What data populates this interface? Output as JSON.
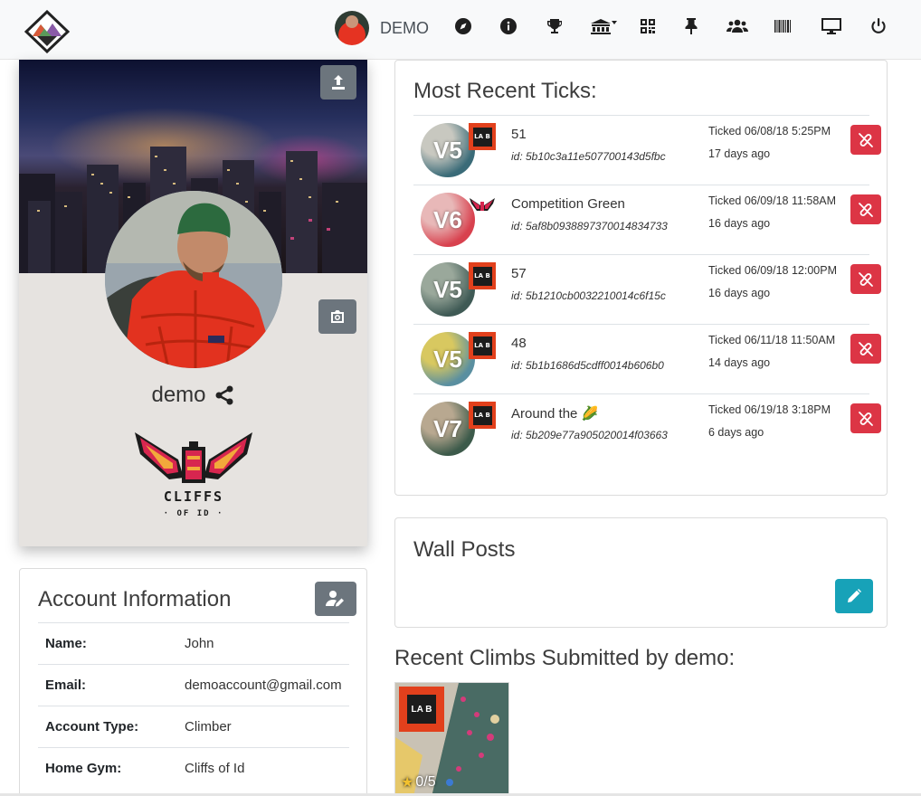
{
  "nav": {
    "username": "DEMO",
    "icons": [
      "compass-icon",
      "info-icon",
      "trophy-icon",
      "gym-dropdown-icon",
      "qr-code-icon",
      "pin-icon",
      "users-icon",
      "barcode-icon",
      "monitor-icon",
      "power-icon"
    ]
  },
  "profile": {
    "username": "demo",
    "gym_logo_text_1": "CLIFFS",
    "gym_logo_text_2": "· OF ID ·"
  },
  "account": {
    "title": "Account Information",
    "rows": [
      {
        "label": "Name:",
        "value": "John"
      },
      {
        "label": "Email:",
        "value": "demoaccount@gmail.com"
      },
      {
        "label": "Account Type:",
        "value": "Climber"
      },
      {
        "label": "Home Gym:",
        "value": "Cliffs of Id"
      }
    ]
  },
  "ticks": {
    "title": "Most Recent Ticks:",
    "items": [
      {
        "grade": "V5",
        "name": "51",
        "id": "id: 5b10c3a11e507700143d5fbc",
        "date": "Ticked 06/08/18 5:25PM",
        "ago": "17 days ago",
        "badge": "LA B",
        "colors": [
          "#3a6b78",
          "#c8c8c0"
        ]
      },
      {
        "grade": "V6",
        "name": "Competition Green",
        "id": "id: 5af8b0938897370014834733",
        "date": "Ticked 06/09/18 11:58AM",
        "ago": "16 days ago",
        "badge": "cliffs",
        "colors": [
          "#d8414e",
          "#e8b8b8"
        ]
      },
      {
        "grade": "V5",
        "name": "57",
        "id": "id: 5b1210cb0032210014c6f15c",
        "date": "Ticked 06/09/18 12:00PM",
        "ago": "16 days ago",
        "badge": "LA B",
        "colors": [
          "#3f5a55",
          "#9aa89b"
        ]
      },
      {
        "grade": "V5",
        "name": "48",
        "id": "id: 5b1b1686d5cdff0014b606b0",
        "date": "Ticked 06/11/18 11:50AM",
        "ago": "14 days ago",
        "badge": "LA B",
        "colors": [
          "#5a8fa0",
          "#d8c860"
        ]
      },
      {
        "grade": "V7",
        "name": "Around the 🌽",
        "id": "id: 5b209e77a905020014f03663",
        "date": "Ticked 06/19/18 3:18PM",
        "ago": "6 days ago",
        "badge": "LA B",
        "colors": [
          "#3c5a4a",
          "#b8a890"
        ]
      }
    ]
  },
  "wall": {
    "title": "Wall Posts"
  },
  "recent": {
    "title": "Recent Climbs Submitted by demo:",
    "climbs": [
      {
        "badge": "LA B",
        "rating": "0/5"
      }
    ]
  },
  "colors": {
    "danger": "#dc3545",
    "info": "#17a2b8",
    "secondary": "#6c757d",
    "badge_orange": "#e2401c"
  }
}
